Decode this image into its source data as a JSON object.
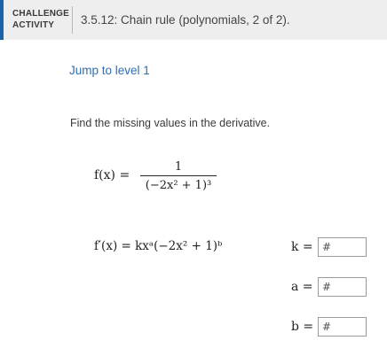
{
  "header": {
    "tag_line1": "CHALLENGE",
    "tag_line2": "ACTIVITY",
    "title": "3.5.12: Chain rule (polynomials, 2 of 2)."
  },
  "level_link": "Jump to level 1",
  "instructions": "Find the missing values in the derivative.",
  "function": {
    "lhs": "f(x) =",
    "numerator": "1",
    "denominator": "(−2x² + 1)³"
  },
  "derivative": "f′(x) = kxᵃ(−2x² + 1)ᵇ",
  "answers": [
    {
      "variable": "k =",
      "placeholder": "#"
    },
    {
      "variable": "a =",
      "placeholder": "#"
    },
    {
      "variable": "b =",
      "placeholder": "#"
    }
  ],
  "colors": {
    "accent": "#1b63a8",
    "link": "#2e6db3",
    "header_bg": "#eeeeee"
  }
}
